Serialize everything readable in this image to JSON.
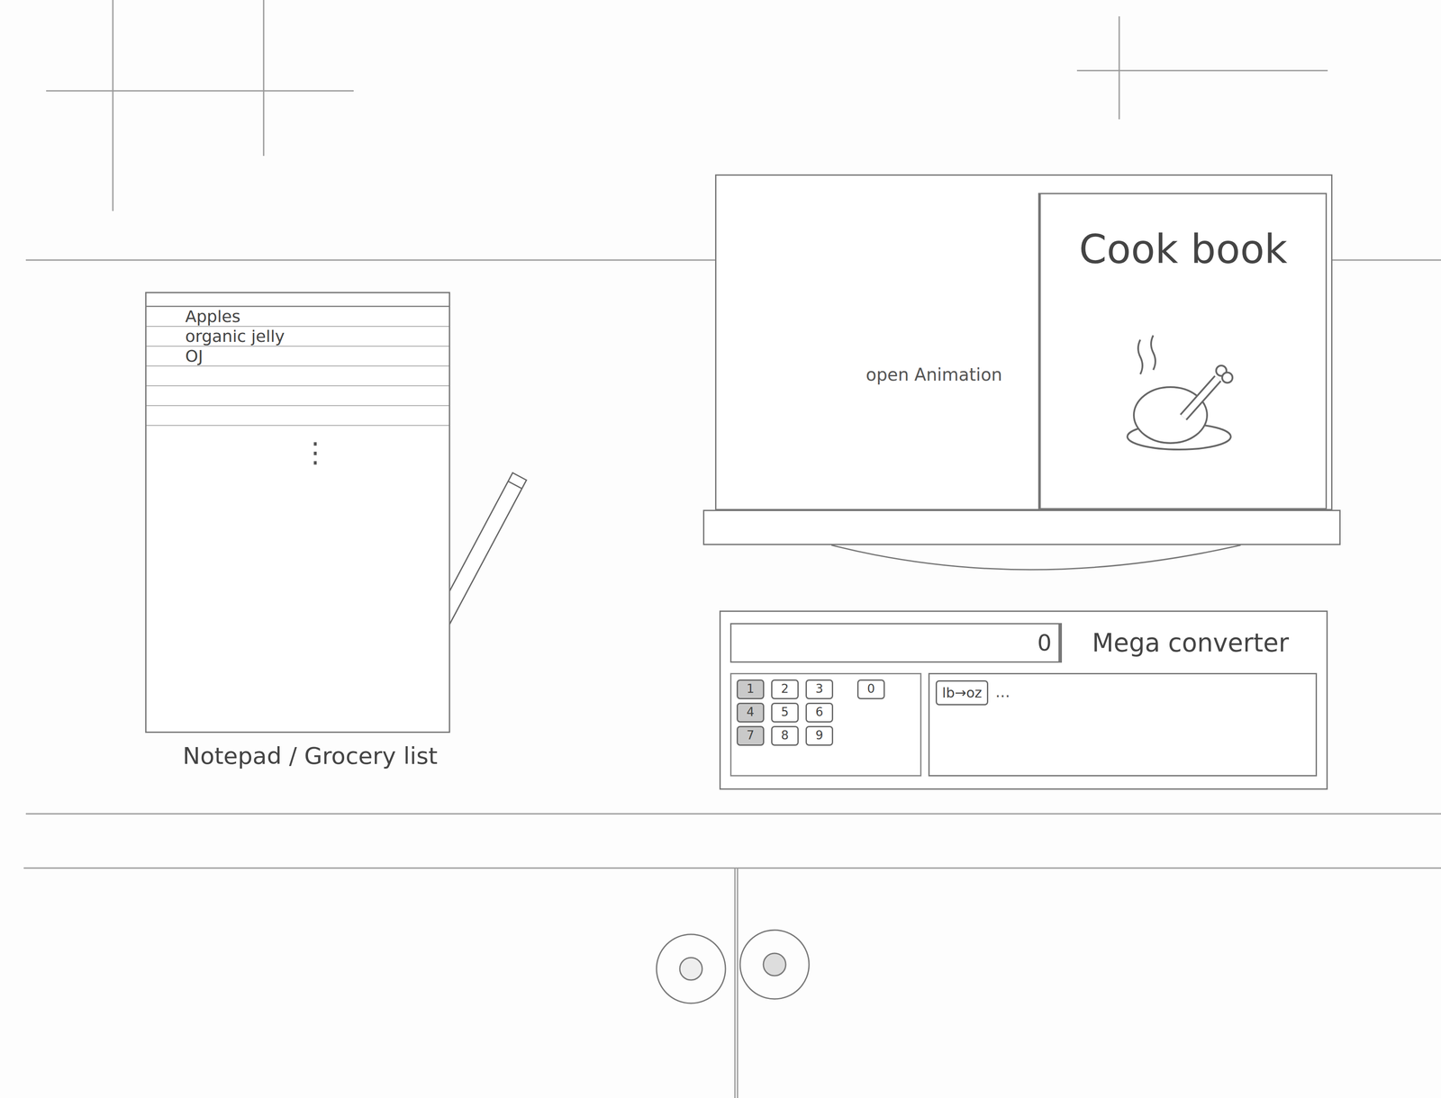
{
  "notepad": {
    "items": [
      "Apples",
      "organic jelly",
      "OJ"
    ],
    "more": "⋮",
    "caption": "Notepad / Grocery list"
  },
  "cookbook": {
    "title": "Cook book",
    "annotation": "open Animation"
  },
  "converter": {
    "display": "0",
    "title": "Mega converter",
    "keypad": [
      [
        {
          "label": "1",
          "shaded": true
        },
        {
          "label": "2",
          "shaded": false
        },
        {
          "label": "3",
          "shaded": false
        },
        {
          "label": "0",
          "shaded": false
        }
      ],
      [
        {
          "label": "4",
          "shaded": true
        },
        {
          "label": "5",
          "shaded": false
        },
        {
          "label": "6",
          "shaded": false
        }
      ],
      [
        {
          "label": "7",
          "shaded": true
        },
        {
          "label": "8",
          "shaded": false
        },
        {
          "label": "9",
          "shaded": false
        }
      ]
    ],
    "conversions": [
      "lb→oz"
    ],
    "more": "..."
  }
}
